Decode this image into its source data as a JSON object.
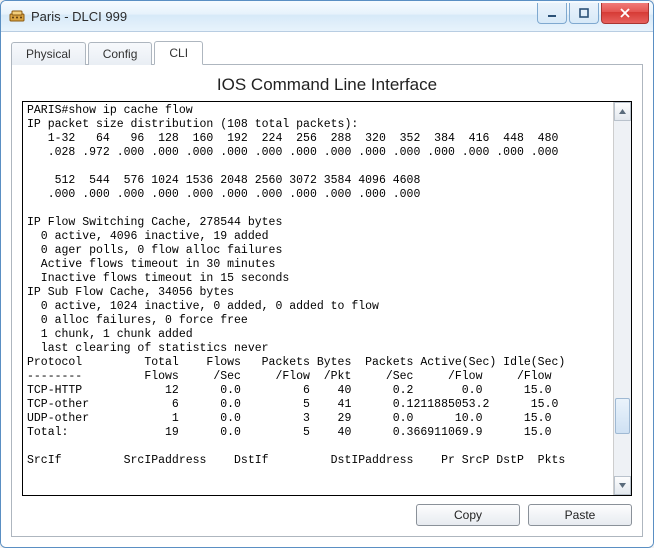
{
  "window": {
    "title": "Paris - DLCI 999"
  },
  "tabs": {
    "physical": "Physical",
    "config": "Config",
    "cli": "CLI",
    "active": "cli"
  },
  "panel": {
    "heading": "IOS Command Line Interface"
  },
  "buttons": {
    "copy": "Copy",
    "paste": "Paste"
  },
  "cli": {
    "prompt_line": "PARIS#show ip cache flow",
    "dist_header": "IP packet size distribution (108 total packets):",
    "dist_sizes_1": "   1-32   64   96  128  160  192  224  256  288  320  352  384  416  448  480",
    "dist_values_1": "   .028 .972 .000 .000 .000 .000 .000 .000 .000 .000 .000 .000 .000 .000 .000",
    "dist_sizes_2": "    512  544  576 1024 1536 2048 2560 3072 3584 4096 4608",
    "dist_values_2": "   .000 .000 .000 .000 .000 .000 .000 .000 .000 .000 .000",
    "switch_cache_header": "IP Flow Switching Cache, 278544 bytes",
    "switch_cache_1": "  0 active, 4096 inactive, 19 added",
    "switch_cache_2": "  0 ager polls, 0 flow alloc failures",
    "switch_cache_3": "  Active flows timeout in 30 minutes",
    "switch_cache_4": "  Inactive flows timeout in 15 seconds",
    "sub_cache_header": "IP Sub Flow Cache, 34056 bytes",
    "sub_cache_1": "  0 active, 1024 inactive, 0 added, 0 added to flow",
    "sub_cache_2": "  0 alloc failures, 0 force free",
    "sub_cache_3": "  1 chunk, 1 chunk added",
    "sub_cache_4": "  last clearing of statistics never",
    "table_hdr1": "Protocol         Total    Flows   Packets Bytes  Packets Active(Sec) Idle(Sec)",
    "table_hdr2": "--------         Flows     /Sec     /Flow  /Pkt     /Sec     /Flow     /Flow",
    "row_tcp_http": "TCP-HTTP            12      0.0         6    40      0.2       0.0      15.0",
    "row_tcp_other": "TCP-other            6      0.0         5    41      0.1211885053.2      15.0",
    "row_udp_other": "UDP-other            1      0.0         3    29      0.0      10.0      15.0",
    "row_total": "Total:              19      0.0         5    40      0.366911069.9      15.0",
    "flow_footer": "SrcIf         SrcIPaddress    DstIf         DstIPaddress    Pr SrcP DstP  Pkts"
  }
}
